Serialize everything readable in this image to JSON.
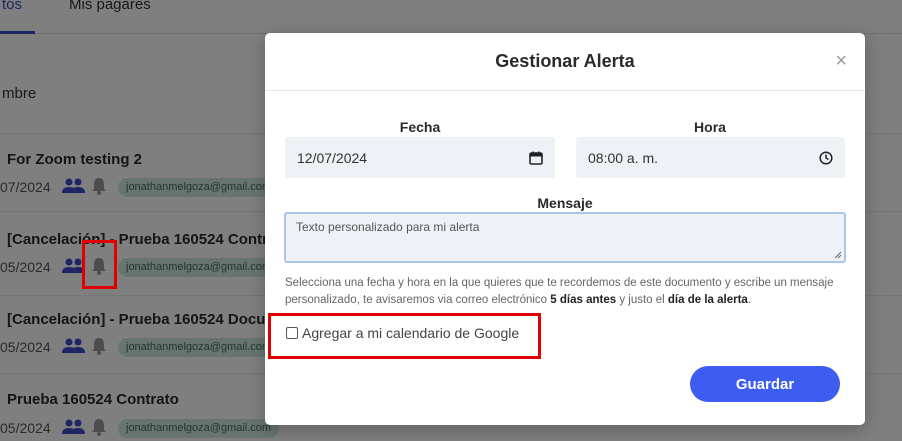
{
  "background": {
    "tabs": [
      {
        "label": "tos"
      },
      {
        "label": "Mis pagares"
      }
    ],
    "column_header": "mbre",
    "rows": [
      {
        "title": "For Zoom testing 2",
        "date": "07/2024",
        "email": "jonathanmelgoza@gmail.com"
      },
      {
        "title": "[Cancelación] - Prueba 160524 Contrato",
        "date": "05/2024",
        "email": "jonathanmelgoza@gmail.com"
      },
      {
        "title": "[Cancelación] - Prueba 160524 Documento",
        "date": "05/2024",
        "email": "jonathanmelgoza@gmail.com"
      },
      {
        "title": "Prueba 160524 Contrato",
        "date": "05/2024",
        "email": "jonathanmelgoza@gmail.com"
      }
    ]
  },
  "modal": {
    "title": "Gestionar Alerta",
    "close_symbol": "×",
    "fecha_label": "Fecha",
    "fecha_value": "12/07/2024",
    "hora_label": "Hora",
    "hora_value": "08:00  a. m.",
    "mensaje_label": "Mensaje",
    "mensaje_placeholder": "Texto personalizado para mi alerta",
    "help_part1": "Selecciona una fecha y hora en la que quieres que te recordemos de este documento y escribe un mensaje personalizado, te avisaremos via correo electrónico ",
    "help_bold1": "5 días antes",
    "help_part2": " y justo el ",
    "help_bold2": "día de la alerta",
    "help_part3": ".",
    "checkbox_label": "Agregar a mi calendario de Google",
    "checkbox_checked": false,
    "save_label": "Guardar"
  },
  "colors": {
    "accent": "#3d5cf0",
    "highlight": "#e00000",
    "email_badge": "#cfe9df"
  },
  "icons": [
    "people-icon",
    "bell-icon",
    "calendar-icon",
    "clock-icon",
    "close-icon"
  ]
}
